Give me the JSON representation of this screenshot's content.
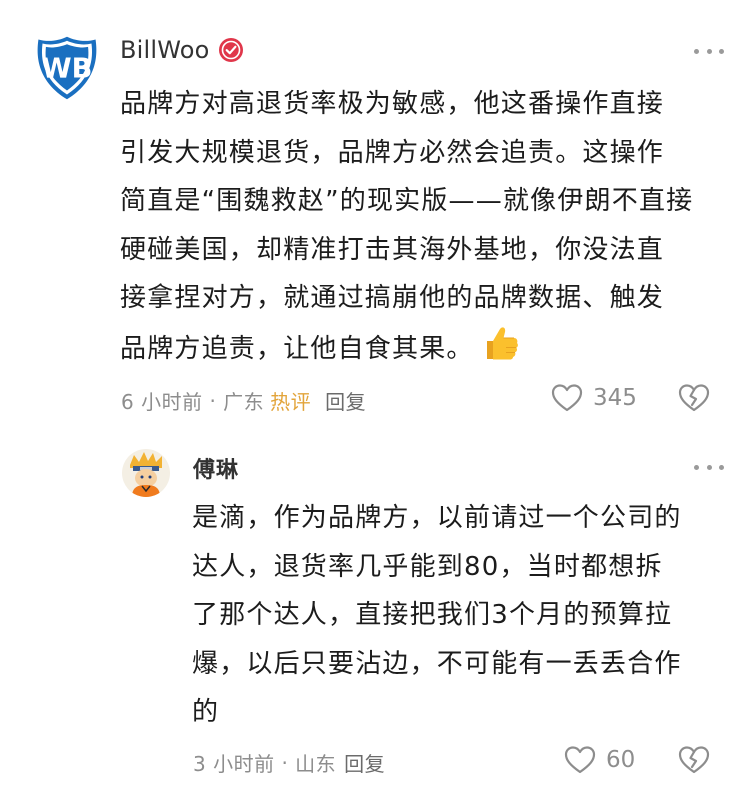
{
  "comment": {
    "author": "BillWoo",
    "text": "品牌方对高退货率极为敏感，他这番操作直接\n引发大规模退货，品牌方必然会追责。这操作\n简直是“围魏救赵”的现实版——就像伊朗不直接\n硬碰美国，却精准打击其海外基地，你没法直\n接拿捏对方，就通过搞崩他的品牌数据、触发\n品牌方追责，让他自食其果。",
    "time": "6 小时前",
    "location": "广东",
    "hot_label": "热评",
    "reply_label": "回复",
    "likes": "345",
    "icons": {
      "avatar": "warner-bros-logo-icon",
      "verified": "verified-badge-icon",
      "emoji": "thumbs-up-icon",
      "like": "heart-icon",
      "dislike": "broken-heart-icon",
      "more": "more-dots-icon"
    }
  },
  "reply": {
    "author": "傅琳",
    "text": "是滴，作为品牌方，以前请过一个公司的\n达人，退货率几乎能到80，当时都想拆\n了那个达人，直接把我们3个月的预算拉\n爆，以后只要沾边，不可能有一丢丢合作\n的",
    "time": "3 小时前",
    "location": "山东",
    "reply_label": "回复",
    "likes": "60"
  },
  "colors": {
    "wb_blue": "#1a6fc0",
    "hot": "#e2a43a",
    "verified": "#e0364a",
    "meta": "#8d8d8d"
  }
}
